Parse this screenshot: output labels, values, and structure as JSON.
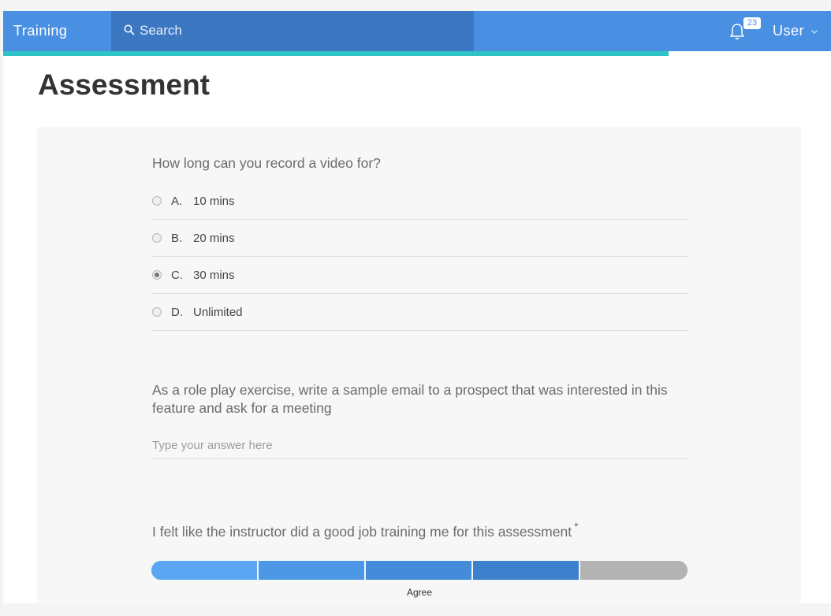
{
  "app": {
    "brand": "Training",
    "search_placeholder": "Search",
    "notifications_count": "23",
    "user_label": "User",
    "progress_fraction": 0.804
  },
  "page": {
    "title": "Assessment"
  },
  "questions": {
    "q1": {
      "text": "How long can you record a video for?",
      "selected": "C",
      "options": [
        {
          "letter": "A.",
          "label": "10 mins"
        },
        {
          "letter": "B.",
          "label": "20 mins"
        },
        {
          "letter": "C.",
          "label": "30 mins"
        },
        {
          "letter": "D.",
          "label": "Unlimited"
        }
      ]
    },
    "q2": {
      "text": "As a role play exercise, write a sample email to a prospect that was interested in this feature and ask for a meeting",
      "placeholder": "Type your answer here",
      "value": ""
    },
    "q3": {
      "text": "I felt like the instructor did a good job training me for this assessment",
      "required_mark": "*",
      "scale_points": 5,
      "selected_point": 4,
      "selected_label": "Agree",
      "segment_colors": [
        "#5aa6f2",
        "#4d98e6",
        "#448cd9",
        "#3d80cb",
        "#b3b3b3"
      ]
    }
  },
  "colors": {
    "accent": "#4a90e2",
    "search_bg": "#3c78c2",
    "progress": "#2ec4c6"
  }
}
